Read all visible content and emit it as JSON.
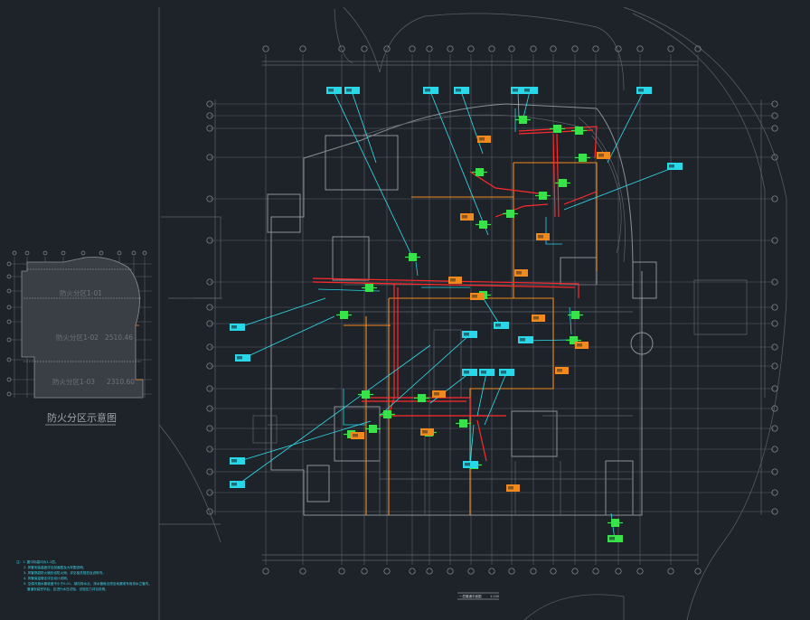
{
  "drawing": {
    "legend": {
      "title": "防火分区示意图",
      "zones": [
        "防火分区1-01",
        "防火分区1-02",
        "防火分区1-03"
      ],
      "areas": [
        "2510.46",
        "2510.46",
        "2310.60"
      ]
    },
    "drawing_title": "一层暖通平面图",
    "scale": "1:100",
    "notes": [
      "注：1. 图中标高均为1-1层。",
      "2. 风管安装高度详见剖面图及大样图说明。",
      "3. 风管穿越防火墙处设防火阀，详见相关规范及说明书。",
      "4. 风管保温做法详见设计说明。",
      "5. 空调冷凝水管坡度不小于0.01，坡向排水点，排水管就近排至地漏或专用排水立管内。",
      "管道安装完毕后，应进行水压试验，试验压力详见说明。"
    ],
    "colors": {
      "background": "#1e232a",
      "grid": "#5b6069",
      "walls": "#8b9097",
      "fire_zone_boundary": "#f08a1c",
      "smoke_duct": "#ff2a2a",
      "supply_duct": "#22d6e6",
      "equipment": "#37e24a",
      "tag": "#28d8e8"
    }
  }
}
